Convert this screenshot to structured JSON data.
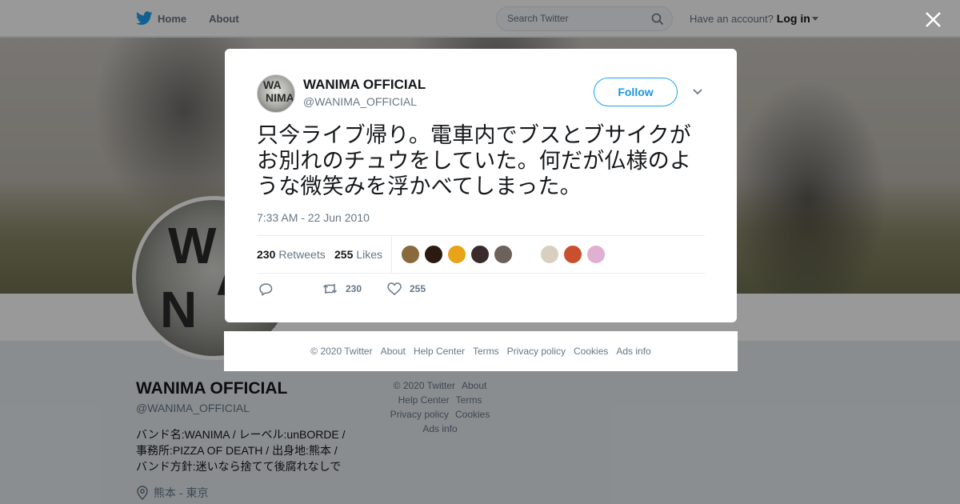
{
  "topbar": {
    "home_label": "Home",
    "about_label": "About",
    "search_placeholder": "Search Twitter",
    "account_prompt": "Have an account?",
    "login_label": "Log in"
  },
  "profile": {
    "name": "WANIMA OFFICIAL",
    "handle": "@WANIMA_OFFICIAL",
    "bio": "バンド名:WANIMA / レーベル:unBORDE / 事務所:PIZZA OF DEATH / 出身地:熊本 / バンド方針:迷いなら捨てて後腐れなしで",
    "location": "熊本 - 東京",
    "avatar_text": "WA NIMA"
  },
  "bg_footer": {
    "items": [
      "© 2020 Twitter",
      "About",
      "Help Center",
      "Terms",
      "Privacy policy",
      "Cookies",
      "Ads info"
    ]
  },
  "tweet": {
    "author_name": "WANIMA OFFICIAL",
    "author_handle": "@WANIMA_OFFICIAL",
    "follow_label": "Follow",
    "text": "只今ライブ帰り。電車内でブスとブサイクがお別れのチュウをしていた。何だが仏様のような微笑みを浮かべてしまった。",
    "timestamp": "7:33 AM - 22 Jun 2010",
    "retweets_count": "230",
    "retweets_label": "Retweets",
    "likes_count": "255",
    "likes_label": "Likes",
    "action_retweets": "230",
    "action_likes": "255",
    "liker_colors": [
      "#8a6a3c",
      "#2a1a10",
      "#e8a317",
      "#3a2a2a",
      "#6b6259",
      "#d8cfc0",
      "#c9502e",
      "#e0b0d0"
    ]
  },
  "modal_footer": {
    "items": [
      "© 2020 Twitter",
      "About",
      "Help Center",
      "Terms",
      "Privacy policy",
      "Cookies",
      "Ads info"
    ]
  },
  "colors": {
    "accent": "#1da1f2",
    "muted_text": "#657786"
  }
}
